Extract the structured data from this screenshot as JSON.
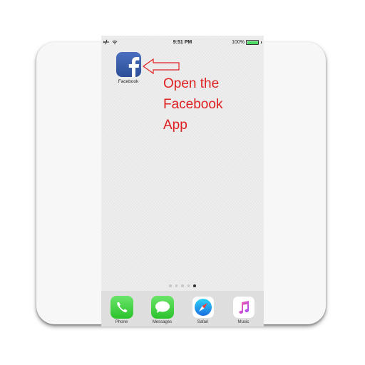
{
  "status_bar": {
    "time": "9:51 PM",
    "battery": "100%",
    "battery_level": 1.0,
    "left_icons": [
      "airplane-mode-icon",
      "wifi-icon"
    ]
  },
  "home_screen": {
    "apps": [
      {
        "label": "Facebook",
        "icon": "facebook-icon"
      }
    ],
    "page_dots": {
      "count": 5,
      "active_index": 4
    }
  },
  "annotation": {
    "lines": [
      "Open the",
      "Facebook",
      "App"
    ],
    "color": "#e02020"
  },
  "dock": {
    "apps": [
      {
        "label": "Phone",
        "icon": "phone-icon"
      },
      {
        "label": "Messages",
        "icon": "messages-icon"
      },
      {
        "label": "Safari",
        "icon": "safari-icon"
      },
      {
        "label": "Music",
        "icon": "music-icon"
      }
    ]
  }
}
